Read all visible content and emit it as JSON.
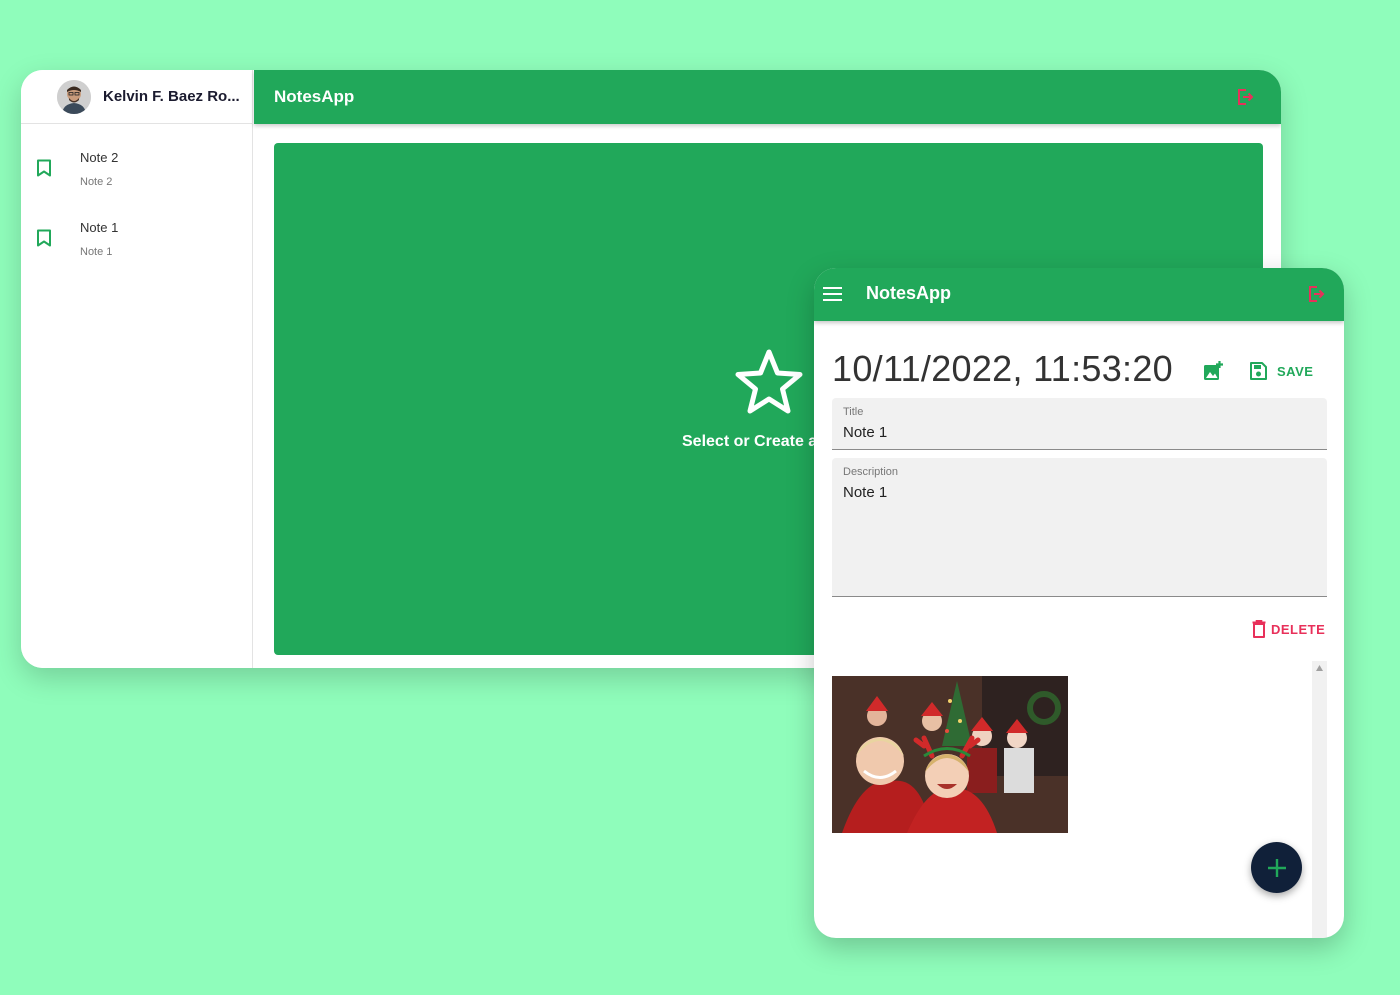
{
  "desktop": {
    "user": {
      "name": "Kelvin F. Baez Ro..."
    },
    "app_title": "NotesApp",
    "notes": [
      {
        "title": "Note 2",
        "description": "Note 2"
      },
      {
        "title": "Note 1",
        "description": "Note 1"
      }
    ],
    "placeholder_text": "Select or Create a"
  },
  "mobile": {
    "app_title": "NotesApp",
    "date": "10/11/2022, 11:53:20",
    "save_label": "SAVE",
    "title_field": {
      "label": "Title",
      "value": "Note 1"
    },
    "description_field": {
      "label": "Description",
      "value": "Note 1"
    },
    "delete_label": "DELETE"
  },
  "colors": {
    "background": "#8ffdbb",
    "primary": "#21a85a",
    "danger": "#e8305a",
    "fab": "#102039"
  },
  "icons": {
    "note": "bookmark-icon",
    "logout": "logout-icon",
    "menu": "menu-icon",
    "add_photo": "add-photo-icon",
    "save": "save-icon",
    "delete": "trash-icon",
    "fab": "plus-icon",
    "empty_state": "star-icon"
  }
}
